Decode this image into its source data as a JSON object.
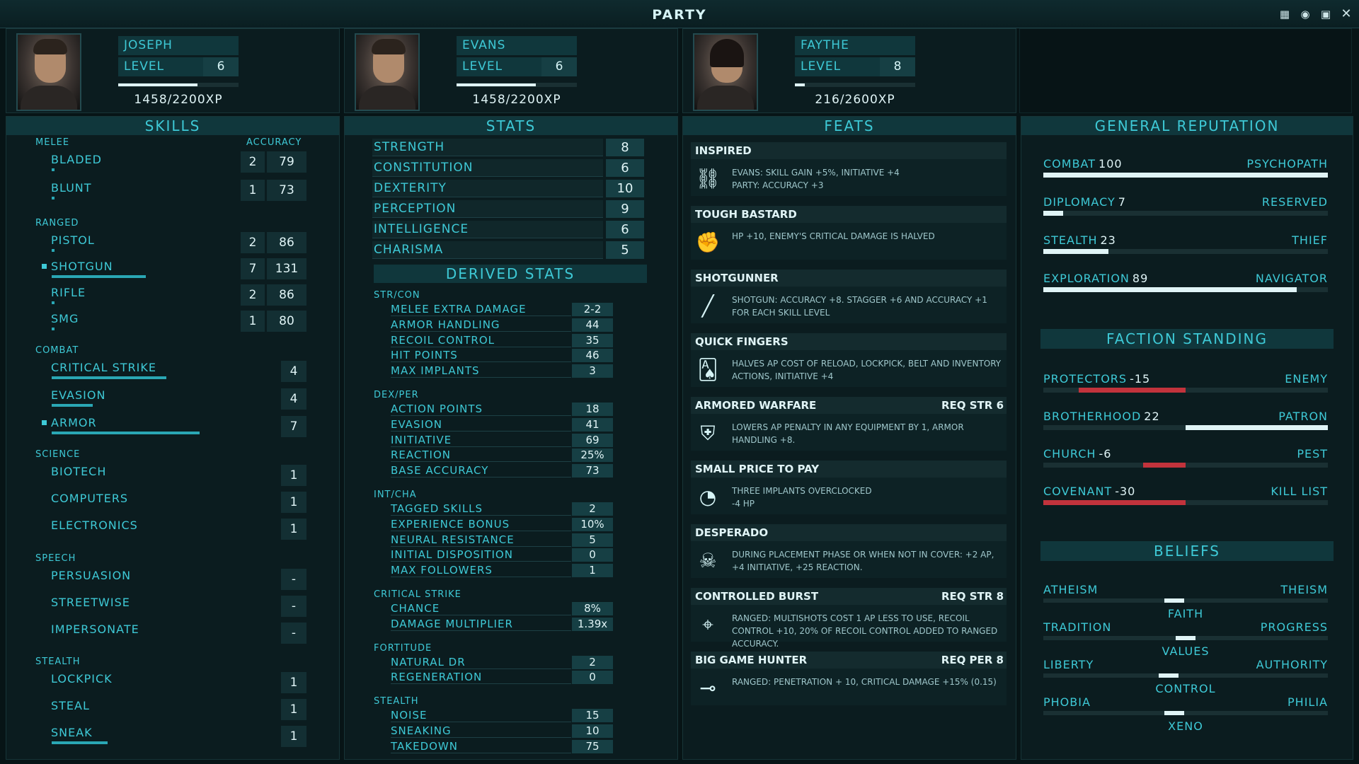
{
  "window": {
    "title": "PARTY",
    "icons": [
      "calendar-icon",
      "brain-icon",
      "monitor-icon",
      "close-icon"
    ]
  },
  "party": [
    {
      "name": "JOSEPH",
      "level_label": "LEVEL",
      "level": "6",
      "xp": "1458/2200XP",
      "xp_fraction": 0.66
    },
    {
      "name": "EVANS",
      "level_label": "LEVEL",
      "level": "6",
      "xp": "1458/2200XP",
      "xp_fraction": 0.66
    },
    {
      "name": "FAYTHE",
      "level_label": "LEVEL",
      "level": "8",
      "xp": "216/2600XP",
      "xp_fraction": 0.08
    }
  ],
  "skills": {
    "title": "SKILLS",
    "accuracy_label": "ACCURACY",
    "melee": {
      "label": "MELEE",
      "items": [
        {
          "name": "BLADED",
          "points": "2",
          "acc": "79",
          "fill": 0.01
        },
        {
          "name": "BLUNT",
          "points": "1",
          "acc": "73",
          "fill": 0.01
        }
      ]
    },
    "ranged": {
      "label": "RANGED",
      "items": [
        {
          "name": "PISTOL",
          "points": "2",
          "acc": "86",
          "fill": 0.01
        },
        {
          "name": "SHOTGUN",
          "points": "7",
          "acc": "131",
          "fill": 0.37
        },
        {
          "name": "RIFLE",
          "points": "2",
          "acc": "86",
          "fill": 0.01
        },
        {
          "name": "SMG",
          "points": "1",
          "acc": "80",
          "fill": 0.01
        }
      ]
    },
    "combat": {
      "label": "COMBAT",
      "items": [
        {
          "name": "CRITICAL STRIKE",
          "points": "4",
          "fill": 0.45
        },
        {
          "name": "EVASION",
          "points": "4",
          "fill": 0.16
        },
        {
          "name": "ARMOR",
          "points": "7",
          "fill": 0.58
        }
      ]
    },
    "science": {
      "label": "SCIENCE",
      "items": [
        {
          "name": "BIOTECH",
          "points": "1"
        },
        {
          "name": "COMPUTERS",
          "points": "1"
        },
        {
          "name": "ELECTRONICS",
          "points": "1"
        }
      ]
    },
    "speech": {
      "label": "SPEECH",
      "items": [
        {
          "name": "PERSUASION",
          "points": "-"
        },
        {
          "name": "STREETWISE",
          "points": "-"
        },
        {
          "name": "IMPERSONATE",
          "points": "-"
        }
      ]
    },
    "stealth": {
      "label": "STEALTH",
      "items": [
        {
          "name": "LOCKPICK",
          "points": "1"
        },
        {
          "name": "STEAL",
          "points": "1"
        },
        {
          "name": "SNEAK",
          "points": "1",
          "fill": 0.22
        }
      ]
    }
  },
  "stats": {
    "title": "STATS",
    "items": [
      {
        "name": "STRENGTH",
        "value": "8"
      },
      {
        "name": "CONSTITUTION",
        "value": "6"
      },
      {
        "name": "DEXTERITY",
        "value": "10"
      },
      {
        "name": "PERCEPTION",
        "value": "9"
      },
      {
        "name": "INTELLIGENCE",
        "value": "6"
      },
      {
        "name": "CHARISMA",
        "value": "5"
      }
    ]
  },
  "derived": {
    "title": "DERIVED STATS",
    "groups": [
      {
        "label": "STR/CON",
        "items": [
          {
            "name": "MELEE EXTRA DAMAGE",
            "value": "2-2"
          },
          {
            "name": "ARMOR HANDLING",
            "value": "44"
          },
          {
            "name": "RECOIL CONTROL",
            "value": "35"
          },
          {
            "name": "HIT POINTS",
            "value": "46"
          },
          {
            "name": "MAX IMPLANTS",
            "value": "3"
          }
        ]
      },
      {
        "label": "DEX/PER",
        "items": [
          {
            "name": "ACTION POINTS",
            "value": "18"
          },
          {
            "name": "EVASION",
            "value": "41"
          },
          {
            "name": "INITIATIVE",
            "value": "69"
          },
          {
            "name": "REACTION",
            "value": "25%"
          },
          {
            "name": "BASE ACCURACY",
            "value": "73"
          }
        ]
      },
      {
        "label": "INT/CHA",
        "items": [
          {
            "name": "TAGGED SKILLS",
            "value": "2"
          },
          {
            "name": "EXPERIENCE BONUS",
            "value": "10%"
          },
          {
            "name": "NEURAL RESISTANCE",
            "value": "5"
          },
          {
            "name": "INITIAL DISPOSITION",
            "value": "0"
          },
          {
            "name": "MAX FOLLOWERS",
            "value": "1"
          }
        ]
      },
      {
        "label": "CRITICAL STRIKE",
        "items": [
          {
            "name": "CHANCE",
            "value": "8%"
          },
          {
            "name": "DAMAGE MULTIPLIER",
            "value": "1.39x"
          }
        ]
      },
      {
        "label": "FORTITUDE",
        "items": [
          {
            "name": "NATURAL DR",
            "value": "2"
          },
          {
            "name": "REGENERATION",
            "value": "0"
          }
        ]
      },
      {
        "label": "STEALTH",
        "items": [
          {
            "name": "NOISE",
            "value": "15"
          },
          {
            "name": "SNEAKING",
            "value": "10"
          },
          {
            "name": "TAKEDOWN",
            "value": "75"
          }
        ]
      }
    ]
  },
  "feats": {
    "title": "FEATS",
    "items": [
      {
        "name": "INSPIRED",
        "req": "",
        "icon": "chain-link-icon",
        "desc": "EVANS: SKILL GAIN +5%, INITIATIVE +4\nPARTY: ACCURACY +3"
      },
      {
        "name": "TOUGH BASTARD",
        "req": "",
        "icon": "fist-icon",
        "desc": "HP +10, ENEMY'S CRITICAL DAMAGE IS HALVED"
      },
      {
        "name": "SHOTGUNNER",
        "req": "",
        "icon": "shotgun-icon",
        "desc": "SHOTGUN: ACCURACY +8. STAGGER +6 AND ACCURACY +1 FOR EACH SKILL LEVEL"
      },
      {
        "name": "QUICK FINGERS",
        "req": "",
        "icon": "cards-icon",
        "desc": "HALVES AP COST OF RELOAD, LOCKPICK, BELT AND INVENTORY ACTIONS, INITIATIVE +4"
      },
      {
        "name": "ARMORED WARFARE",
        "req": "REQ STR 6",
        "icon": "armor-icon",
        "desc": "LOWERS AP PENALTY IN ANY EQUIPMENT BY 1, ARMOR HANDLING +8."
      },
      {
        "name": "SMALL PRICE TO PAY",
        "req": "",
        "icon": "gauge-icon",
        "desc": "THREE IMPLANTS OVERCLOCKED\n-4 HP"
      },
      {
        "name": "DESPERADO",
        "req": "",
        "icon": "cowboy-icon",
        "desc": "DURING PLACEMENT PHASE OR WHEN NOT IN COVER: +2 AP, +4 INITIATIVE, +25 REACTION."
      },
      {
        "name": "CONTROLLED BURST",
        "req": "REQ STR 8",
        "icon": "crosshair-icon",
        "desc": "RANGED: MULTISHOTS COST 1 AP LESS TO USE, RECOIL CONTROL +10, 20% OF RECOIL CONTROL ADDED TO RANGED ACCURACY."
      },
      {
        "name": "BIG GAME HUNTER",
        "req": "REQ PER 8",
        "icon": "rifle-icon",
        "desc": "RANGED: PENETRATION + 10, CRITICAL DAMAGE +15% (0.15)"
      }
    ]
  },
  "reputation": {
    "title": "GENERAL REPUTATION",
    "items": [
      {
        "name": "COMBAT",
        "value": "100",
        "tag": "PSYCHOPATH",
        "fill": 1.0
      },
      {
        "name": "DIPLOMACY",
        "value": "7",
        "tag": "RESERVED",
        "fill": 0.07
      },
      {
        "name": "STEALTH",
        "value": "23",
        "tag": "THIEF",
        "fill": 0.23
      },
      {
        "name": "EXPLORATION",
        "value": "89",
        "tag": "NAVIGATOR",
        "fill": 0.89
      }
    ]
  },
  "factions": {
    "title": "FACTION STANDING",
    "items": [
      {
        "name": "PROTECTORS",
        "value": "-15",
        "tag": "ENEMY",
        "pos": -0.75
      },
      {
        "name": "BROTHERHOOD",
        "value": "22",
        "tag": "PATRON",
        "pos": 1.0
      },
      {
        "name": "CHURCH",
        "value": "-6",
        "tag": "PEST",
        "pos": -0.3
      },
      {
        "name": "COVENANT",
        "value": "-30",
        "tag": "KILL LIST",
        "pos": -1.0
      }
    ]
  },
  "beliefs": {
    "title": "BELIEFS",
    "items": [
      {
        "left": "ATHEISM",
        "right": "THEISM",
        "center": "FAITH",
        "pos": -0.08
      },
      {
        "left": "TRADITION",
        "right": "PROGRESS",
        "center": "VALUES",
        "pos": 0.0
      },
      {
        "left": "LIBERTY",
        "right": "AUTHORITY",
        "center": "CONTROL",
        "pos": -0.12
      },
      {
        "left": "PHOBIA",
        "right": "PHILIA",
        "center": "XENO",
        "pos": -0.08
      }
    ]
  }
}
